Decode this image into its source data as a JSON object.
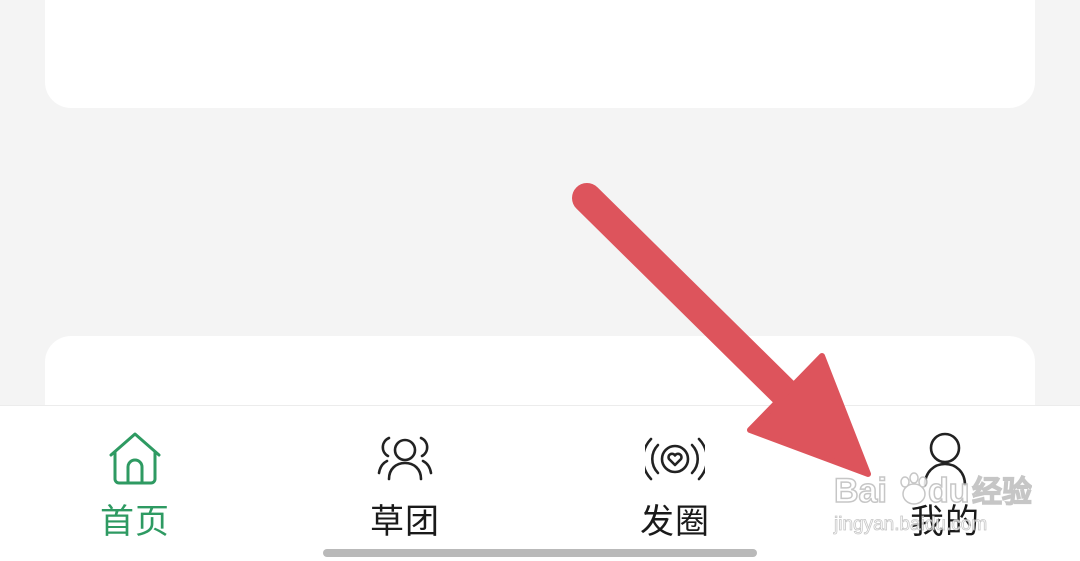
{
  "tabbar": {
    "tabs": [
      {
        "label": "首页",
        "icon": "home-icon",
        "active": true
      },
      {
        "label": "草团",
        "icon": "group-icon",
        "active": false
      },
      {
        "label": "发圈",
        "icon": "broadcast-heart-icon",
        "active": false
      },
      {
        "label": "我的",
        "icon": "profile-icon",
        "active": false
      }
    ]
  },
  "colors": {
    "background": "#f4f4f4",
    "card": "#ffffff",
    "active_tab": "#2e9a62",
    "inactive_tab": "#1a1a1a",
    "annotation_arrow": "#dd545c"
  },
  "annotation": {
    "type": "arrow",
    "target": "tab-profile"
  },
  "watermark": {
    "text": "Baidu经验",
    "subtext": "jingyan.baidu.com"
  }
}
